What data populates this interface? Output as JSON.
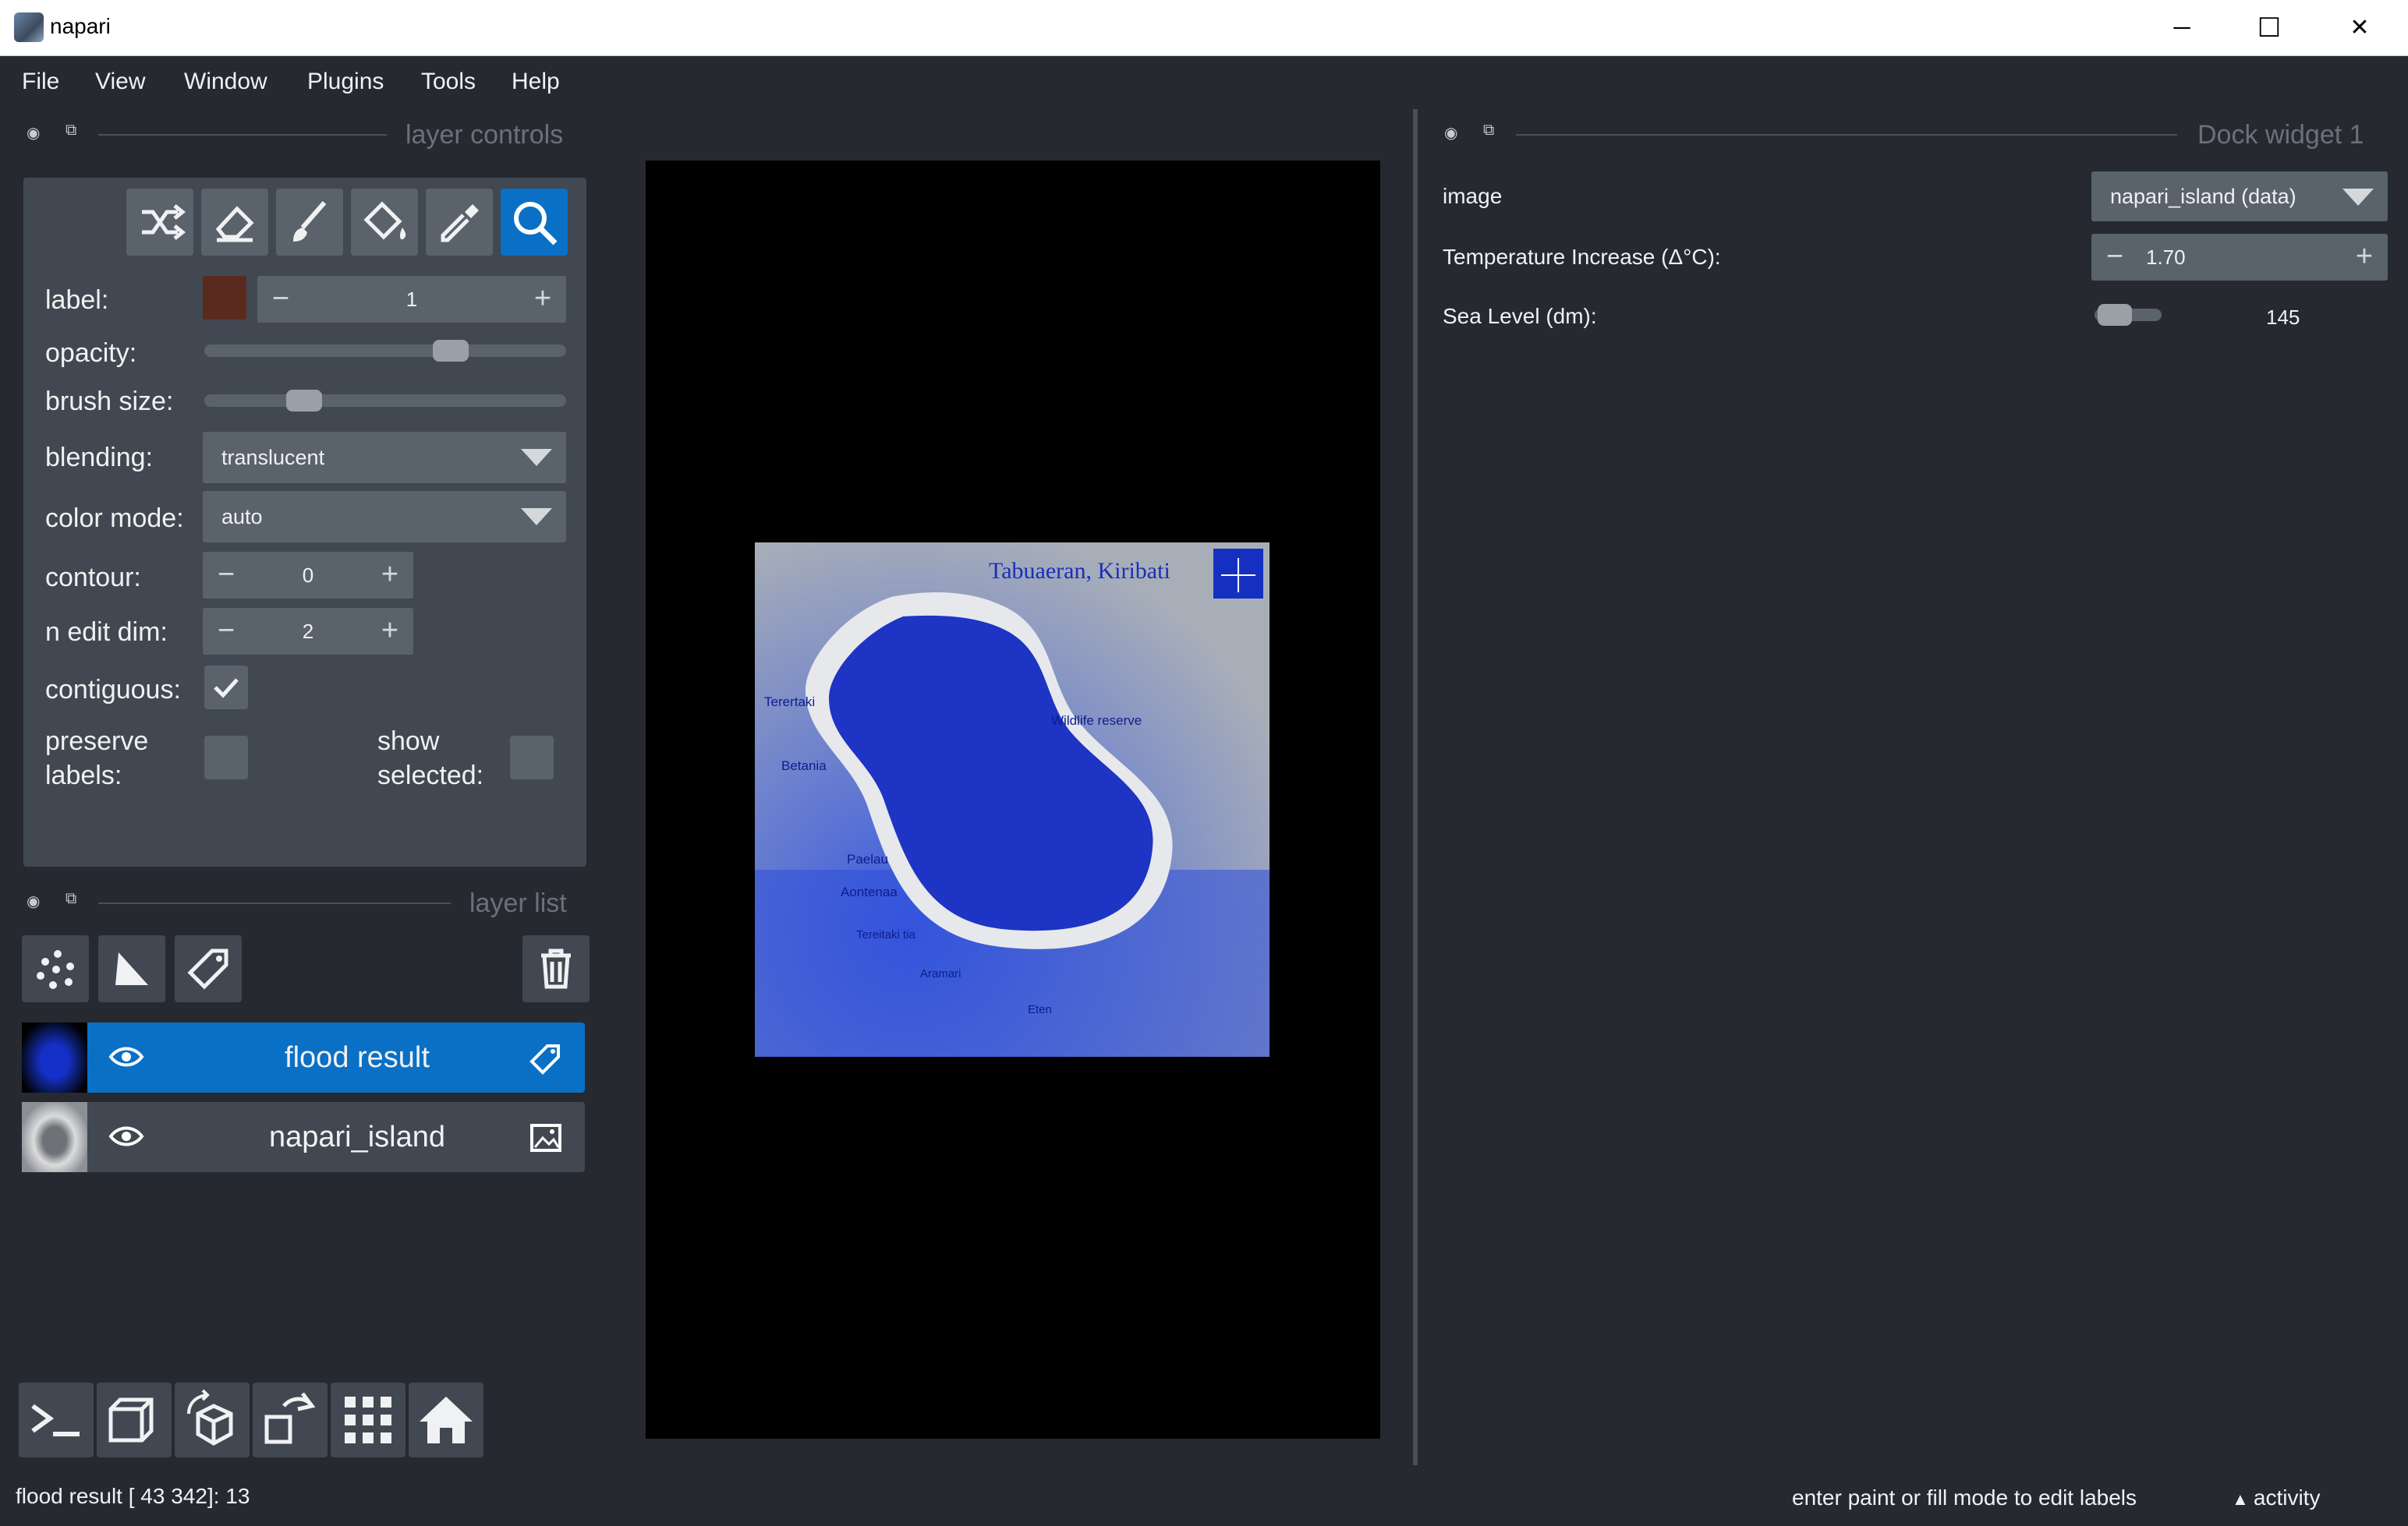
{
  "window": {
    "title": "napari",
    "controls": [
      "─",
      "☐",
      "✕"
    ]
  },
  "menu": [
    "File",
    "View",
    "Window",
    "Plugins",
    "Tools",
    "Help"
  ],
  "layer_controls": {
    "header": "layer controls",
    "tools": [
      "shuffle-colors",
      "erase",
      "paint",
      "fill",
      "pick",
      "pan-zoom"
    ],
    "label": {
      "text": "label:",
      "value": "1",
      "swatch_color": "#5a2a1e"
    },
    "opacity": {
      "text": "opacity:",
      "value": 0.7
    },
    "brush_size": {
      "text": "brush size:",
      "value": 0.25
    },
    "blending": {
      "text": "blending:",
      "value": "translucent"
    },
    "color_mode": {
      "text": "color mode:",
      "value": "auto"
    },
    "contour": {
      "text": "contour:",
      "value": "0"
    },
    "n_edit_dim": {
      "text": "n edit dim:",
      "value": "2"
    },
    "contiguous": {
      "text": "contiguous:",
      "checked": true
    },
    "preserve_labels": {
      "text1": "preserve",
      "text2": "labels:",
      "checked": false
    },
    "show_selected": {
      "text1": "show",
      "text2": "selected:",
      "checked": false
    }
  },
  "layer_list": {
    "header": "layer list",
    "layers": [
      {
        "name": "flood result",
        "type_icon": "labels-icon",
        "selected": true,
        "visible": true
      },
      {
        "name": "napari_island",
        "type_icon": "image-icon",
        "selected": false,
        "visible": true
      }
    ]
  },
  "canvas": {
    "map_title": "Tabuaeran, Kiribati",
    "place_labels": [
      "Terertaki",
      "Betania",
      "Wildlife reserve",
      "Paelau",
      "Aontenaa",
      "Tereitaki tia",
      "Aramari",
      "Eten"
    ]
  },
  "dock_widget": {
    "header": "Dock widget 1",
    "image": {
      "label": "image",
      "value": "napari_island (data)"
    },
    "temperature": {
      "label": "Temperature Increase (Δ°C):",
      "value": "1.70"
    },
    "sea_level": {
      "label": "Sea Level (dm):",
      "value": "145",
      "fraction": 0.1
    }
  },
  "status": {
    "left": "flood result [ 43 342]: 13",
    "right": "enter paint or fill mode to edit labels",
    "activity": "activity"
  },
  "colors": {
    "accent": "#0a70c6",
    "background": "#262930",
    "panel": "#414851",
    "widget": "#5a626c"
  }
}
